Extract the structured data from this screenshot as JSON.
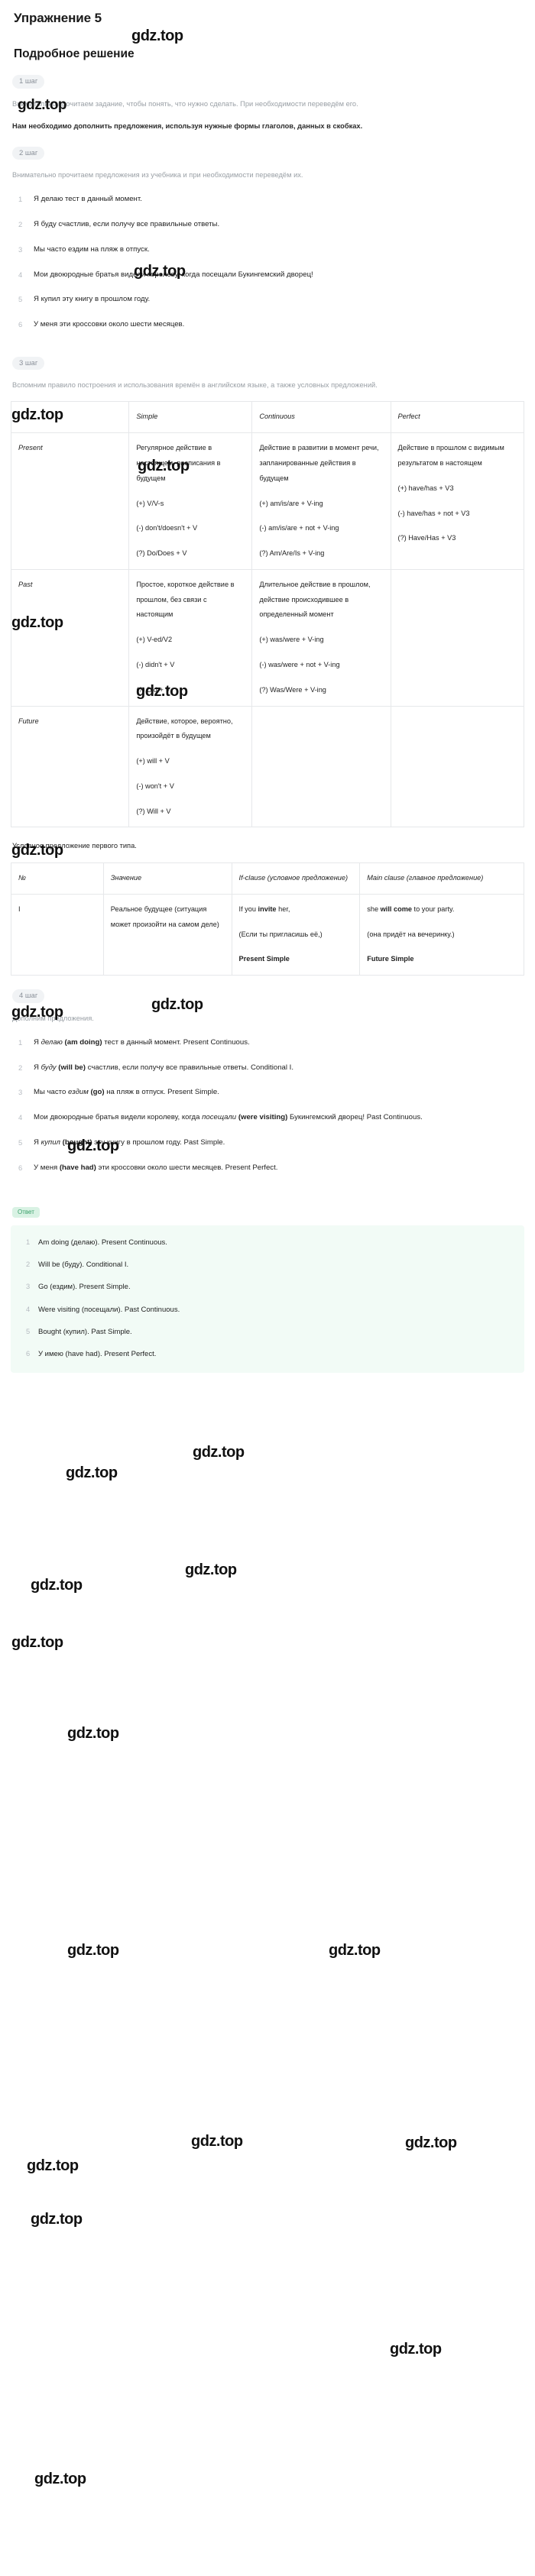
{
  "exercise": {
    "title": "Упражнение 5"
  },
  "solution": {
    "title": "Подробное решение"
  },
  "watermark": {
    "text": "gdz.top"
  },
  "steps": {
    "step1": {
      "badge": "1 шаг",
      "para1": "Внимательно прочитаем задание, чтобы понять, что нужно сделать. При необходимости переведём его.",
      "para2": "Нам необходимо дополнить предложения, используя нужные формы глаголов, данных в скобках."
    },
    "step2": {
      "badge": "2 шаг",
      "intro": "Внимательно прочитаем предложения из учебника и при необходимости переведём их.",
      "sentences": [
        "Я делаю тест в данный момент.",
        "Я буду счастлив, если получу все правильные ответы.",
        "Мы часто ездим на пляж в отпуск.",
        "Мои двоюродные братья видели королеву, когда посещали Букингемский дворец!",
        "Я купил эту книгу в прошлом году.",
        "У меня эти кроссовки около шести месяцев."
      ]
    },
    "step3": {
      "badge": "3 шаг",
      "intro": "Вспомним правило построения и использования времён в английском языке, а также условных предложений.",
      "tense_table": {
        "headers": [
          "",
          "Simple",
          "Continuous",
          "Perfect"
        ],
        "rows": [
          {
            "label": "Present",
            "simple": {
              "desc": "Регулярное действие в настоящем, расписания в будущем",
              "forms": [
                "(+) V/V-s",
                "(-) don't/doesn't + V",
                "(?) Do/Does + V"
              ]
            },
            "continuous": {
              "desc": "Действие в развитии в момент речи, запланированные действия в будущем",
              "forms": [
                "(+) am/is/are + V-ing",
                "(-) am/is/are + not + V-ing",
                "(?) Am/Are/Is + V-ing"
              ]
            },
            "perfect": {
              "desc": "Действие в прошлом с видимым результатом в настоящем",
              "forms": [
                "(+) have/has + V3",
                "(-) have/has + not + V3",
                "(?) Have/Has + V3"
              ]
            }
          },
          {
            "label": "Past",
            "simple": {
              "desc": "Простое, короткое действие в прошлом, без связи с настоящим",
              "forms": [
                "(+) V-ed/V2",
                "(-) didn't + V",
                "(?) Did + V"
              ]
            },
            "continuous": {
              "desc": "Длительное действие в прошлом, действие происходившее в определенный момент",
              "forms": [
                "(+) was/were + V-ing",
                "(-) was/were + not + V-ing",
                "(?) Was/Were + V-ing"
              ]
            },
            "perfect": {
              "desc": "",
              "forms": []
            }
          },
          {
            "label": "Future",
            "simple": {
              "desc": "Действие, которое, вероятно, произойдёт в будущем",
              "forms": [
                "(+) will + V",
                "(-) won't + V",
                "(?) Will + V"
              ]
            },
            "continuous": {
              "desc": "",
              "forms": []
            },
            "perfect": {
              "desc": "",
              "forms": []
            }
          }
        ]
      },
      "conditional_caption": "Условное предложение первого типа.",
      "conditional_table": {
        "headers": [
          "№",
          "Значение",
          "If-clause (условное предложение)",
          "Main clause (главное предложение)"
        ],
        "rows": [
          {
            "num": "I",
            "meaning": "Реальное будущее (ситуация может произойти на самом деле)",
            "if_clause_en_pre": "If you ",
            "if_clause_en_bold": "invite",
            "if_clause_en_post": " her,",
            "if_clause_ru": "(Если ты пригласишь её,)",
            "if_clause_tense": "Present Simple",
            "main_clause_en_pre": "she ",
            "main_clause_en_bold": "will come",
            "main_clause_en_post": " to your party.",
            "main_clause_ru": "(она придёт на вечеринку.)",
            "main_clause_tense": "Future Simple"
          }
        ]
      }
    },
    "step4": {
      "badge": "4 шаг",
      "intro": "Дополним предложения.",
      "items": [
        {
          "pre": "Я ",
          "italic": "делаю",
          "bold_paren": "(am doing)",
          "post": " тест в данный момент. Present Continuous."
        },
        {
          "pre": "Я ",
          "italic": "буду",
          "bold_paren": "(will be)",
          "post": " счастлив, если получу все правильные ответы. Conditional I."
        },
        {
          "pre": "Мы часто ",
          "italic": "ездим",
          "bold_paren": "(go)",
          "post": " на пляж в отпуск. Present Simple."
        },
        {
          "pre": "Мои двоюродные братья видели королеву, когда ",
          "italic": "посещали",
          "bold_paren": "(were visiting)",
          "post": " Букингемский дворец! Past Continuous."
        },
        {
          "pre": "Я ",
          "italic": "купил",
          "bold_paren": "(bought)",
          "post": " эту книгу в прошлом году. Past Simple."
        },
        {
          "pre": "У меня ",
          "italic": "",
          "bold_paren": "(have had)",
          "post": " эти кроссовки около шести месяцев. Present Perfect."
        }
      ]
    }
  },
  "answer": {
    "badge": "Ответ",
    "items": [
      "Am doing (делаю). Present Continuous.",
      "Will be (буду). Conditional I.",
      "Go (ездим). Present Simple.",
      "Were visiting (посещали). Past Continuous.",
      "Bought (купил). Past Simple.",
      "У имею (have had). Present Perfect."
    ]
  }
}
